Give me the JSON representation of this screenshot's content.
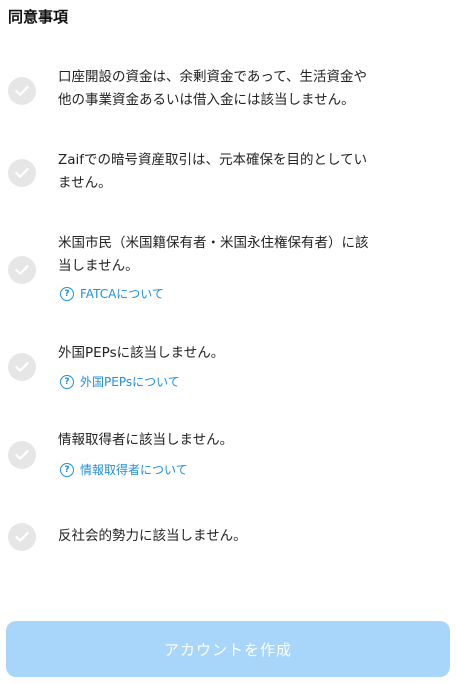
{
  "header": {
    "title": "同意事項"
  },
  "items": [
    {
      "text": "口座開設の資金は、余剰資金であって、生活資金や\n他の事業資金あるいは借入金には該当しません。"
    },
    {
      "text": "Zaifでの暗号資産取引は、元本確保を目的としてい\nません。"
    },
    {
      "text": "米国市民（米国籍保有者・米国永住権保有者）に該\n当しません。",
      "link": "FATCAについて"
    },
    {
      "text": "外国PEPsに該当しません。",
      "link": "外国PEPsについて"
    },
    {
      "text": "情報取得者に該当しません。",
      "link": "情報取得者について"
    },
    {
      "text": "反社会的勢力に該当しません。"
    }
  ],
  "help_icon_glyph": "?",
  "footer": {
    "create_button_label": "アカウントを作成"
  },
  "colors": {
    "link": "#1d8fe0",
    "check_inactive": "#e6e6e6",
    "button_disabled": "#a8d6fb"
  },
  "icons": {
    "check": "check-icon",
    "help": "question-circle-icon"
  }
}
